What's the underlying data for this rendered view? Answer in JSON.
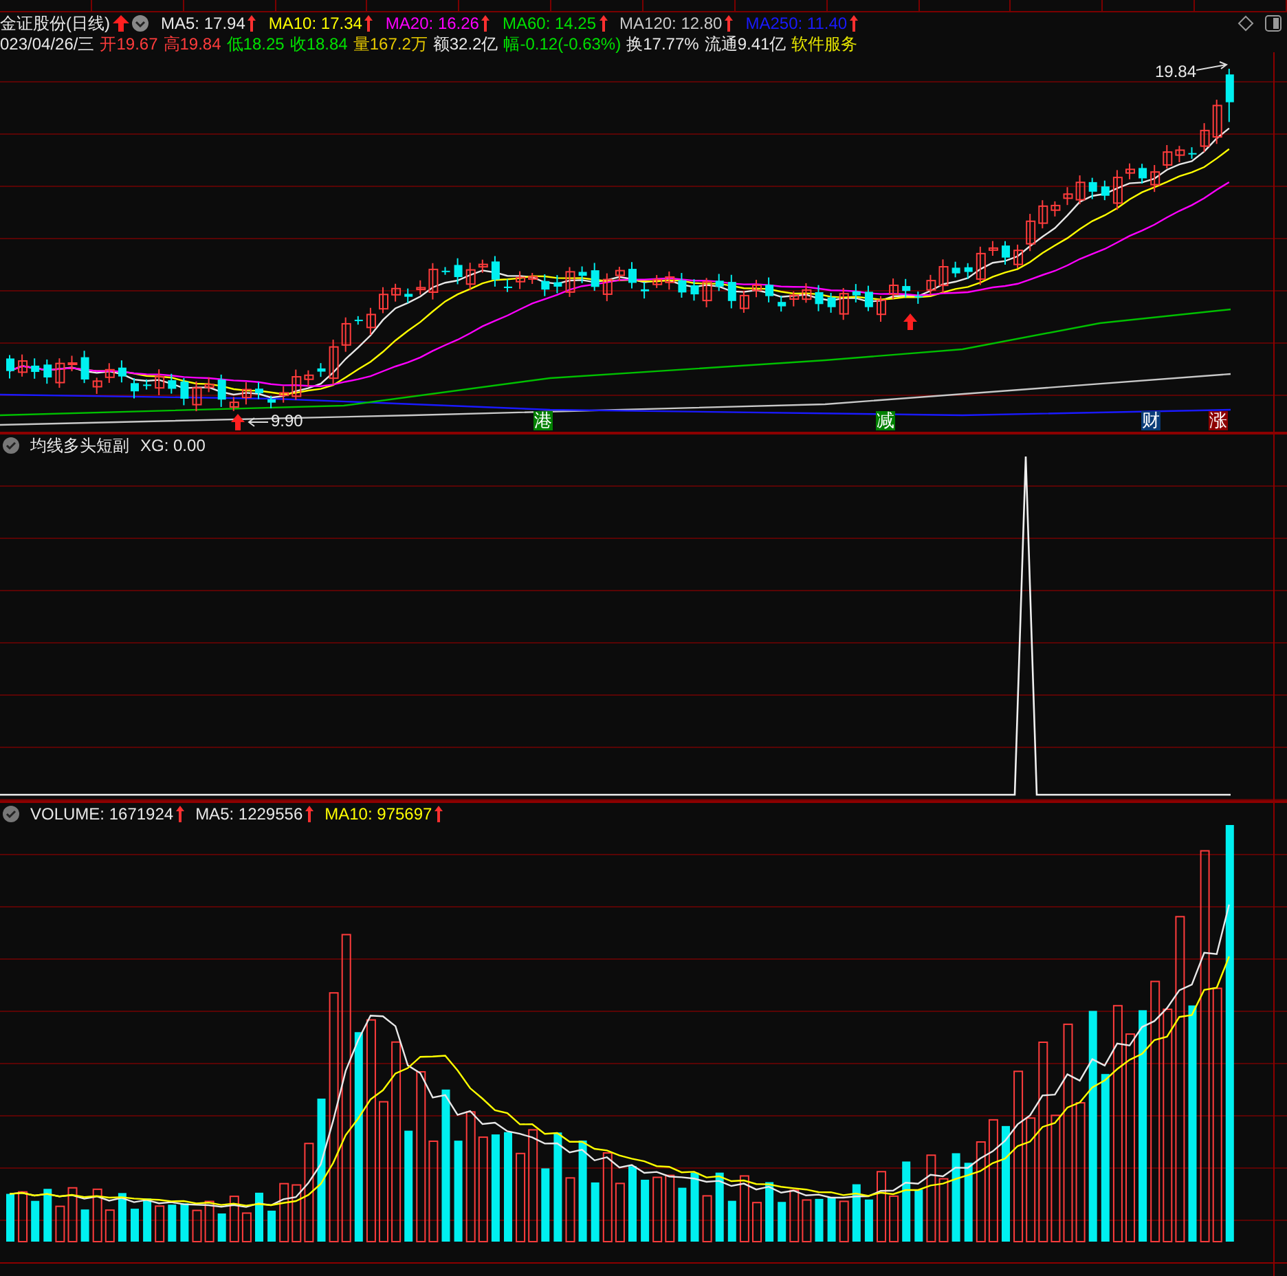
{
  "stock": {
    "title": "金证股份(日线)"
  },
  "ma_lines": [
    {
      "text": "MA5: 17.94",
      "color": "#e8e8e8"
    },
    {
      "text": "MA10: 17.34",
      "color": "#ffff00"
    },
    {
      "text": "MA20: 16.26",
      "color": "#ff00ff"
    },
    {
      "text": "MA60: 14.25",
      "color": "#00e000"
    },
    {
      "text": "MA120: 12.80",
      "color": "#c8c8c8"
    },
    {
      "text": "MA250: 11.40",
      "color": "#1a1aff"
    }
  ],
  "quote": [
    {
      "text": "023/04/26/三",
      "color": "#e8e8e8"
    },
    {
      "text": "开19.67",
      "color": "#ff3c3c"
    },
    {
      "text": "高19.84",
      "color": "#ff3c3c"
    },
    {
      "text": "低18.25",
      "color": "#00e000"
    },
    {
      "text": "收18.84",
      "color": "#00e000"
    },
    {
      "text": "量167.2万",
      "color": "#e6c800"
    },
    {
      "text": "额32.2亿",
      "color": "#e8e8e8"
    },
    {
      "text": "幅-0.12(-0.63%)",
      "color": "#00e000"
    },
    {
      "text": "换17.77%",
      "color": "#e8e8e8"
    },
    {
      "text": "流通9.41亿",
      "color": "#e8e8e8"
    },
    {
      "text": "软件服务",
      "color": "#e6e600"
    }
  ],
  "main_chart": {
    "high_label": "19.84",
    "low_label": "9.90",
    "markers": [
      {
        "text": "港",
        "color": "#008000"
      },
      {
        "text": "减",
        "color": "#008000"
      },
      {
        "text": "财",
        "color": "#0a3c78"
      },
      {
        "text": "涨",
        "color": "#8c0000"
      }
    ]
  },
  "indicator": {
    "title": "均线多头短副",
    "reading": "XG: 0.00"
  },
  "volume": {
    "items": [
      {
        "text": "VOLUME: 1671924",
        "color": "#e8e8e8"
      },
      {
        "text": "MA5: 1229556",
        "color": "#e8e8e8"
      },
      {
        "text": "MA10: 975697",
        "color": "#ffff00"
      }
    ]
  }
}
